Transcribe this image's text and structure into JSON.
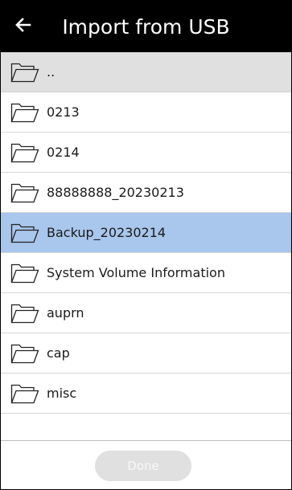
{
  "header": {
    "title": "Import from USB",
    "back_icon": "arrow-left-icon"
  },
  "folders": [
    {
      "label": "..",
      "state": "parent"
    },
    {
      "label": "0213",
      "state": "normal"
    },
    {
      "label": "0214",
      "state": "normal"
    },
    {
      "label": "88888888_20230213",
      "state": "normal"
    },
    {
      "label": "Backup_20230214",
      "state": "selected"
    },
    {
      "label": "System Volume Information",
      "state": "normal"
    },
    {
      "label": "auprn",
      "state": "normal"
    },
    {
      "label": "cap",
      "state": "normal"
    },
    {
      "label": "misc",
      "state": "normal"
    }
  ],
  "footer": {
    "done_label": "Done",
    "done_enabled": false
  },
  "colors": {
    "header_bg": "#000000",
    "parent_row_bg": "#e0e0e0",
    "selected_row_bg": "#a9c6ec",
    "done_button_bg": "#e0e0e0"
  }
}
